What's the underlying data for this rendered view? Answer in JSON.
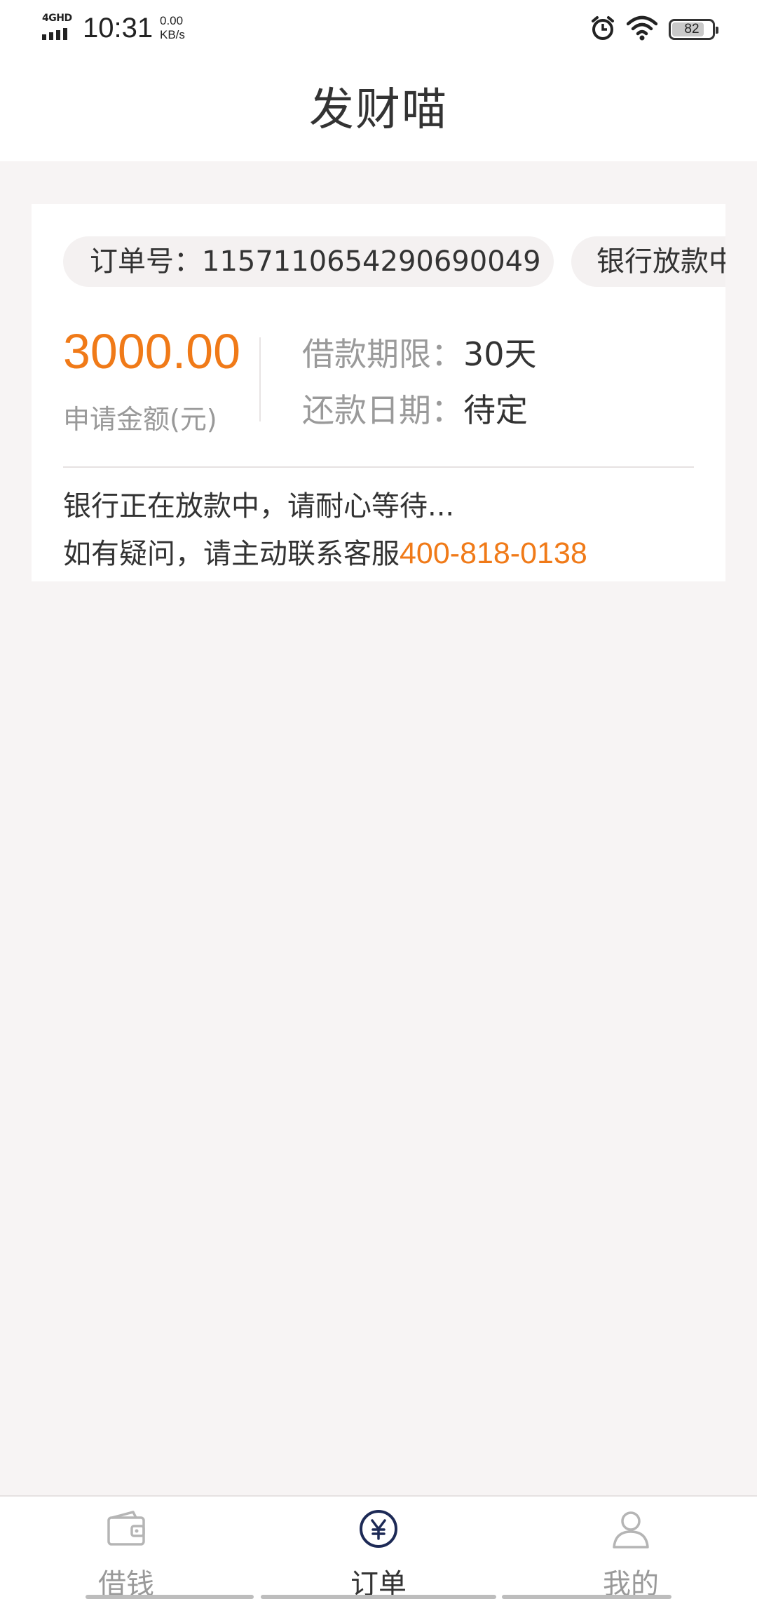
{
  "status_bar": {
    "network": "4GHD",
    "time": "10:31",
    "speed_value": "0.00",
    "speed_unit": "KB/s",
    "battery_level": "82",
    "battery_fraction": 0.82,
    "icons": [
      "alarm-icon",
      "wifi-icon",
      "battery-icon"
    ]
  },
  "header": {
    "title": "发财喵"
  },
  "order": {
    "number_label": "订单号：",
    "number": "1157110654290690049",
    "status": "银行放款中",
    "amount": "3000.00",
    "amount_label": "申请金额(元)",
    "term_label": "借款期限：",
    "term_value": "30天",
    "repay_label": "还款日期：",
    "repay_value": "待定",
    "message_line1": "银行正在放款中，请耐心等待...",
    "message_line2_prefix": "如有疑问，请主动联系客服",
    "phone": "400-818-0138"
  },
  "tabbar": {
    "items": [
      {
        "label": "借钱",
        "icon": "wallet-icon",
        "active": false
      },
      {
        "label": "订单",
        "icon": "yen-circle-icon",
        "active": true
      },
      {
        "label": "我的",
        "icon": "user-icon",
        "active": false
      }
    ]
  },
  "colors": {
    "accent": "#f07a18",
    "background": "#f7f4f4",
    "card": "#ffffff",
    "muted_text": "#999999",
    "active_tab": "#1d2a56"
  }
}
